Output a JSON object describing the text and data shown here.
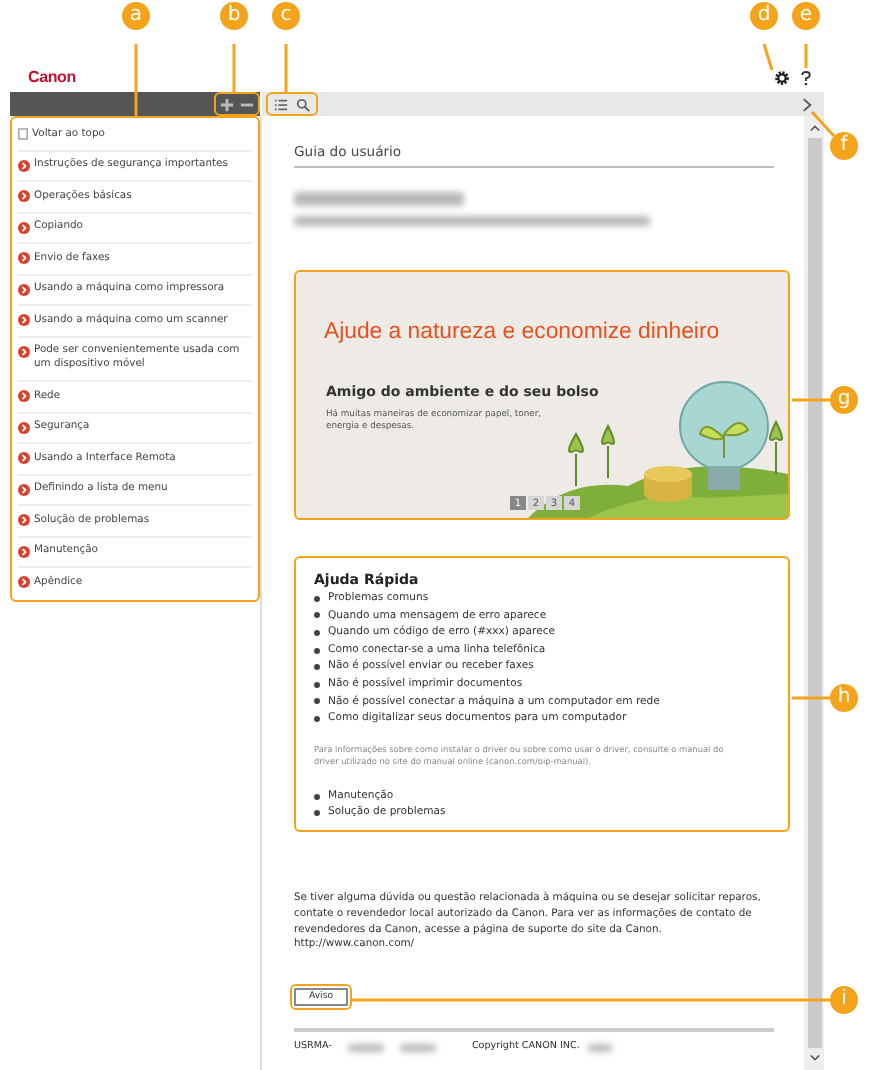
{
  "header": {
    "logo": "Canon"
  },
  "callouts": [
    {
      "letter": "a"
    },
    {
      "letter": "b"
    },
    {
      "letter": "c"
    },
    {
      "letter": "d"
    },
    {
      "letter": "e"
    },
    {
      "letter": "f"
    },
    {
      "letter": "g"
    },
    {
      "letter": "h"
    },
    {
      "letter": "i"
    }
  ],
  "sidebar": {
    "items": [
      {
        "label": "Voltar ao topo",
        "kind": "top"
      },
      {
        "label": "Instruções de segurança importantes",
        "kind": "chapter"
      },
      {
        "label": "Operações básicas",
        "kind": "chapter"
      },
      {
        "label": "Copiando",
        "kind": "chapter"
      },
      {
        "label": "Envio de faxes",
        "kind": "chapter"
      },
      {
        "label": "Usando a máquina como impressora",
        "kind": "chapter"
      },
      {
        "label": "Usando a máquina como um scanner",
        "kind": "chapter"
      },
      {
        "label": "Pode ser convenientemente usada com um dispositivo móvel",
        "kind": "chapter"
      },
      {
        "label": "Rede",
        "kind": "chapter"
      },
      {
        "label": "Segurança",
        "kind": "chapter"
      },
      {
        "label": "Usando a Interface Remota",
        "kind": "chapter"
      },
      {
        "label": "Definindo a lista de menu",
        "kind": "chapter"
      },
      {
        "label": "Solução de problemas",
        "kind": "chapter"
      },
      {
        "label": "Manutenção",
        "kind": "chapter"
      },
      {
        "label": "Apêndice",
        "kind": "chapter"
      }
    ]
  },
  "main": {
    "heading": "Guia do usuário",
    "banner": {
      "title": "Ajude a natureza e economize dinheiro",
      "subtitle": "Amigo do ambiente e do seu bolso",
      "text": "Há muitas maneiras de economizar papel, toner, energia e despesas.",
      "pages": [
        {
          "label": "1",
          "selected": true
        },
        {
          "label": "2",
          "selected": false
        },
        {
          "label": "3",
          "selected": false
        },
        {
          "label": "4",
          "selected": false
        }
      ]
    },
    "quick_help": {
      "title": "Ajuda Rápida",
      "items": [
        "Problemas comuns",
        "Quando uma mensagem de erro aparece",
        "Quando um código de erro (#xxx) aparece",
        "Como conectar-se a uma linha telefônica",
        "Não é possível enviar ou receber faxes",
        "Não é possível imprimir documentos",
        "Não é possível conectar a máquina a um computador em rede",
        "Como digitalizar seus documentos para um computador"
      ],
      "note": "Para informações sobre como instalar o driver ou sobre como usar o driver, consulte o manual do driver utilizado no site do manual online (canon.com/oip-manual).",
      "more_items": [
        "Manutenção",
        "Solução de problemas"
      ]
    },
    "contact": {
      "text": "Se tiver alguma dúvida ou questão relacionada à máquina ou se desejar solicitar reparos, contate o revendedor local autorizado da Canon. Para ver as informações de contato de revendedores da Canon, acesse a página de suporte do site da Canon.",
      "link": "http://www.canon.com/"
    },
    "notice_button": "Aviso",
    "footer": {
      "code": "USRMA-",
      "copyright": "Copyright CANON INC."
    }
  }
}
